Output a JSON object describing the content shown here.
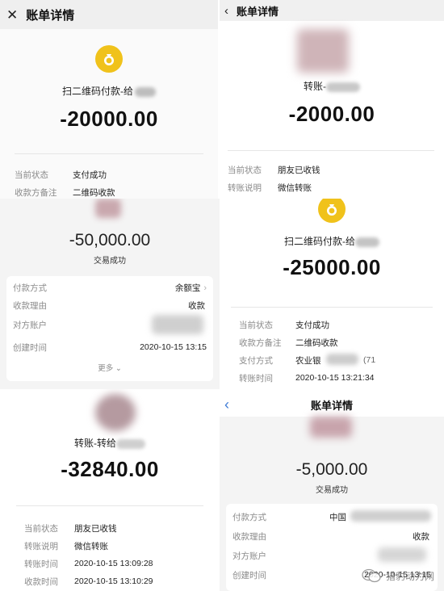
{
  "panel1": {
    "nav_title": "账单详情",
    "payee": "扫二维码付款-给",
    "amount": "-20000.00",
    "rows": [
      {
        "k": "当前状态",
        "v": "支付成功"
      },
      {
        "k": "收款方备注",
        "v": "二维码收款"
      }
    ]
  },
  "panel2": {
    "payee": "转账-",
    "amount": "-2000.00",
    "rows": [
      {
        "k": "当前状态",
        "v": "朋友已收钱"
      },
      {
        "k": "转账说明",
        "v": "微信转账"
      }
    ]
  },
  "panel3": {
    "amount": "-50,000.00",
    "status": "交易成功",
    "rows": [
      {
        "k": "付款方式",
        "v": "余额宝"
      },
      {
        "k": "收款理由",
        "v": "收款"
      },
      {
        "k": "对方账户",
        "v": ""
      },
      {
        "k": "创建时间",
        "v": "2020-10-15 13:15"
      }
    ],
    "more": "更多"
  },
  "panel4": {
    "payee": "扫二维码付款-给",
    "amount": "-25000.00",
    "rows": [
      {
        "k": "当前状态",
        "v": "支付成功"
      },
      {
        "k": "收款方备注",
        "v": "二维码收款"
      },
      {
        "k": "支付方式",
        "v": "农业银",
        "v2": "(71"
      },
      {
        "k": "转账时间",
        "v": "2020-10-15 13:21:34"
      }
    ]
  },
  "panel5": {
    "payee": "转账-转给",
    "amount": "-32840.00",
    "rows": [
      {
        "k": "当前状态",
        "v": "朋友已收钱"
      },
      {
        "k": "转账说明",
        "v": "微信转账"
      },
      {
        "k": "转账时间",
        "v": "2020-10-15 13:09:28"
      },
      {
        "k": "收款时间",
        "v": "2020-10-15 13:10:29"
      }
    ]
  },
  "panel6": {
    "nav_title": "账单详情",
    "amount": "-5,000.00",
    "status": "交易成功",
    "rows": [
      {
        "k": "付款方式",
        "v": "中国"
      },
      {
        "k": "收款理由",
        "v": "收款"
      },
      {
        "k": "对方账户",
        "v": ""
      },
      {
        "k": "创建时间",
        "v": "2020-10-15 13:15"
      }
    ]
  },
  "watermark": {
    "text": "猎豹动力网"
  },
  "colors": {
    "coin": "#f0c21b",
    "back_arrow": "#3d7bd6",
    "divider": "#e6e6e6",
    "label": "#8a8a8a"
  }
}
